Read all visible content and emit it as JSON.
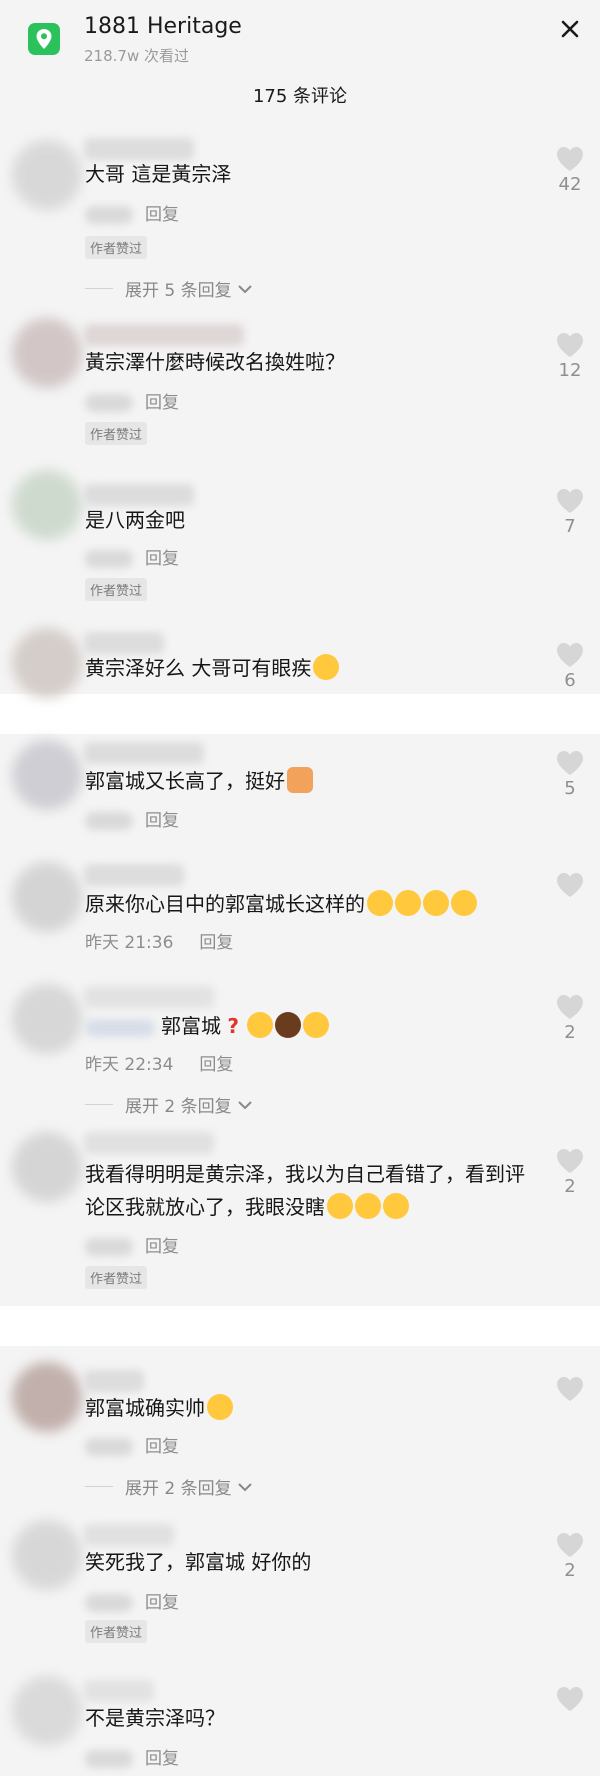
{
  "header": {
    "title": "1881 Heritage",
    "views": "218.7w 次看过",
    "comment_count": "175 条评论",
    "close_icon": "close-icon",
    "location_icon": "location-pin-icon",
    "accent": "#2bc25b"
  },
  "comments": [
    {
      "text": "大哥 這是黃宗泽",
      "reply": "回复",
      "badge": "作者赞过",
      "likes": "42",
      "expand": "展开 5 条回复"
    },
    {
      "text": "黃宗澤什麼時候改名換姓啦？",
      "reply": "回复",
      "badge": "作者赞过",
      "likes": "12"
    },
    {
      "text": "是八两金吧",
      "reply": "回复",
      "badge": "作者赞过",
      "likes": "7"
    },
    {
      "text": "黄宗泽好么 大哥可有眼疾",
      "likes": "6"
    },
    {
      "text": "郭富城又长高了，挺好",
      "reply": "回复",
      "likes": "5"
    },
    {
      "text": "原来你心目中的郭富城长这样的",
      "time": "昨天 21:36",
      "reply": "回复"
    },
    {
      "text": "郭富城",
      "time": "昨天 22:34",
      "reply": "回复",
      "likes": "2",
      "expand": "展开 2 条回复"
    },
    {
      "text": "我看得明明是黄宗泽，我以为自己看错了，看到评论区我就放心了，我眼没瞎",
      "reply": "回复",
      "badge": "作者赞过",
      "likes": "2"
    },
    {
      "text": "郭富城确实帅",
      "reply": "回复",
      "expand": "展开 2 条回复"
    },
    {
      "text": "笑死我了，郭富城 好你的",
      "reply": "回复",
      "badge": "作者赞过",
      "likes": "2"
    },
    {
      "text": "不是黄宗泽吗？",
      "reply": "回复"
    }
  ]
}
